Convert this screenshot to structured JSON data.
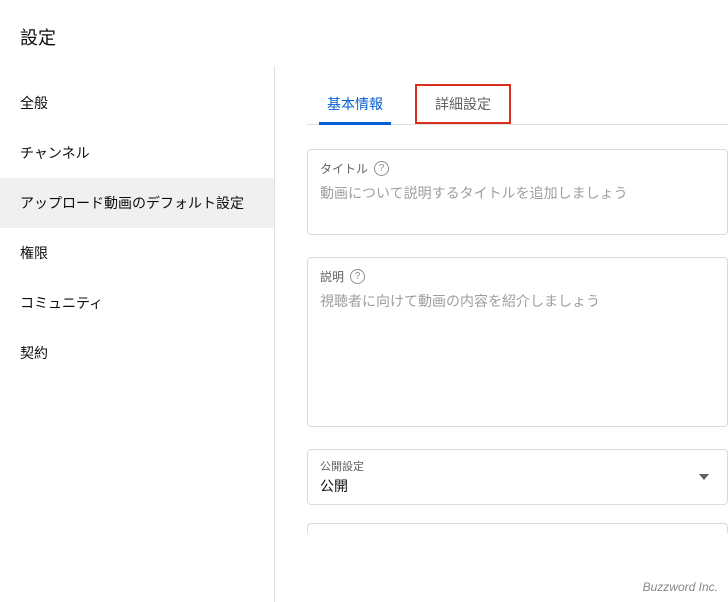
{
  "header": {
    "title": "設定"
  },
  "sidebar": {
    "items": [
      {
        "label": "全般",
        "active": false
      },
      {
        "label": "チャンネル",
        "active": false
      },
      {
        "label": "アップロード動画のデフォルト設定",
        "active": true
      },
      {
        "label": "権限",
        "active": false
      },
      {
        "label": "コミュニティ",
        "active": false
      },
      {
        "label": "契約",
        "active": false
      }
    ]
  },
  "tabs": [
    {
      "label": "基本情報",
      "active": true,
      "highlighted": false
    },
    {
      "label": "詳細設定",
      "active": false,
      "highlighted": true
    }
  ],
  "fields": {
    "title": {
      "label": "タイトル",
      "placeholder": "動画について説明するタイトルを追加しましょう",
      "value": ""
    },
    "description": {
      "label": "説明",
      "placeholder": "視聴者に向けて動画の内容を紹介しましょう",
      "value": ""
    },
    "visibility": {
      "label": "公開設定",
      "value": "公開"
    }
  },
  "watermark": "Buzzword Inc."
}
